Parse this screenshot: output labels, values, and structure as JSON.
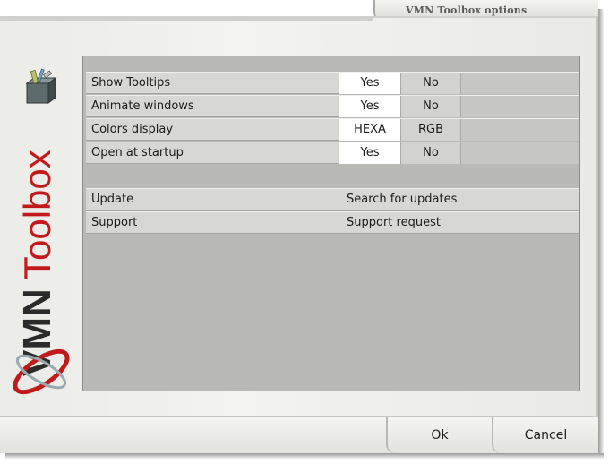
{
  "window": {
    "title": "VMN Toolbox options"
  },
  "branding": {
    "logo_text_part1": "VMN",
    "logo_text_part2": "Toolbox",
    "icon": "toolbox-icon",
    "accent_color": "#c21a1a",
    "dark_color": "#2b2b2b"
  },
  "options": [
    {
      "label": "Show Tooltips",
      "choice_a": "Yes",
      "choice_b": "No",
      "selected": "Yes"
    },
    {
      "label": "Animate windows",
      "choice_a": "Yes",
      "choice_b": "No",
      "selected": "Yes"
    },
    {
      "label": "Colors display",
      "choice_a": "HEXA",
      "choice_b": "RGB",
      "selected": "HEXA"
    },
    {
      "label": "Open at startup",
      "choice_a": "Yes",
      "choice_b": "No",
      "selected": "Yes"
    }
  ],
  "links": [
    {
      "label": "Update",
      "action": "Search for updates"
    },
    {
      "label": "Support",
      "action": "Support request"
    }
  ],
  "buttons": {
    "ok": "Ok",
    "cancel": "Cancel"
  }
}
